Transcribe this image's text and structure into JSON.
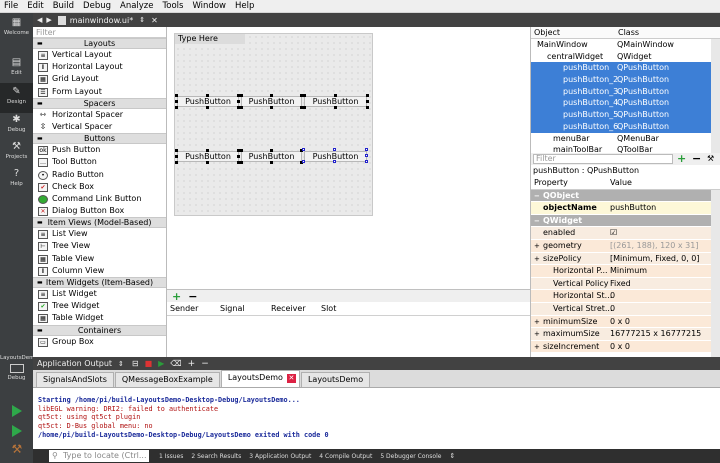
{
  "menubar": [
    "File",
    "Edit",
    "Build",
    "Debug",
    "Analyze",
    "Tools",
    "Window",
    "Help"
  ],
  "modes": [
    {
      "label": "Welcome",
      "icon": "grid-icon"
    },
    {
      "label": "Edit",
      "icon": "document-icon"
    },
    {
      "label": "Design",
      "icon": "pencil-icon"
    },
    {
      "label": "Debug",
      "icon": "bug-icon"
    },
    {
      "label": "Projects",
      "icon": "wrench-icon"
    },
    {
      "label": "Help",
      "icon": "help-icon"
    }
  ],
  "target": {
    "project": "LayoutsDemo",
    "mode": "Debug"
  },
  "editor": {
    "filename": "mainwindow.ui*"
  },
  "widgetbox": {
    "filter_placeholder": "Filter",
    "layouts": {
      "title": "Layouts",
      "items": [
        "Vertical Layout",
        "Horizontal Layout",
        "Grid Layout",
        "Form Layout"
      ]
    },
    "spacers": {
      "title": "Spacers",
      "items": [
        "Horizontal Spacer",
        "Vertical Spacer"
      ]
    },
    "buttons": {
      "title": "Buttons",
      "items": [
        "Push Button",
        "Tool Button",
        "Radio Button",
        "Check Box",
        "Command Link Button",
        "Dialog Button Box"
      ]
    },
    "itemviews": {
      "title": "Item Views (Model-Based)",
      "items": [
        "List View",
        "Tree View",
        "Table View",
        "Column View"
      ]
    },
    "itemwidgets": {
      "title": "Item Widgets (Item-Based)",
      "items": [
        "List Widget",
        "Tree Widget",
        "Table Widget"
      ]
    },
    "containers": {
      "title": "Containers",
      "items": [
        "Group Box"
      ]
    }
  },
  "form": {
    "title": "Type Here",
    "row1": [
      "PushButton",
      "PushButton",
      "PushButton"
    ],
    "row2": [
      "PushButton",
      "PushButton",
      "PushButton"
    ]
  },
  "signals": {
    "add": "+",
    "remove": "−",
    "columns": [
      "Sender",
      "Signal",
      "Receiver",
      "Slot"
    ]
  },
  "objinspector": {
    "columns": [
      "Object",
      "Class"
    ],
    "rows": [
      {
        "object": "MainWindow",
        "class": "QMainWindow",
        "sel": false,
        "indent": 6
      },
      {
        "object": "centralWidget",
        "class": "QWidget",
        "sel": false,
        "indent": 16
      },
      {
        "object": "pushButton",
        "class": "QPushButton",
        "sel": true,
        "indent": 32
      },
      {
        "object": "pushButton_2",
        "class": "QPushButton",
        "sel": true,
        "indent": 32
      },
      {
        "object": "pushButton_3",
        "class": "QPushButton",
        "sel": true,
        "indent": 32
      },
      {
        "object": "pushButton_4",
        "class": "QPushButton",
        "sel": true,
        "indent": 32
      },
      {
        "object": "pushButton_5",
        "class": "QPushButton",
        "sel": true,
        "indent": 32
      },
      {
        "object": "pushButton_6",
        "class": "QPushButton",
        "sel": true,
        "indent": 32
      },
      {
        "object": "menuBar",
        "class": "QMenuBar",
        "sel": false,
        "indent": 22
      },
      {
        "object": "mainToolBar",
        "class": "QToolBar",
        "sel": false,
        "indent": 22
      }
    ]
  },
  "propeditor": {
    "filter_placeholder": "Filter",
    "class_line": "pushButton : QPushButton",
    "columns": [
      "Property",
      "Value"
    ],
    "rows": [
      {
        "name": "QObject",
        "value": "",
        "kind": "grp"
      },
      {
        "name": "objectName",
        "value": "pushButton",
        "kind": "a",
        "bold": true
      },
      {
        "name": "QWidget",
        "value": "",
        "kind": "grp"
      },
      {
        "name": "enabled",
        "value": "☑",
        "kind": "c"
      },
      {
        "name": "geometry",
        "value": "[(261, 188), 120 x 31]",
        "kind": "d",
        "exp": true,
        "grey": true
      },
      {
        "name": "sizePolicy",
        "value": "[Minimum, Fixed, 0, 0]",
        "kind": "c",
        "exp": true
      },
      {
        "name": "Horizontal P...",
        "value": "Minimum",
        "kind": "d",
        "sub": true
      },
      {
        "name": "Vertical Policy",
        "value": "Fixed",
        "kind": "c",
        "sub": true
      },
      {
        "name": "Horizontal St...",
        "value": "0",
        "kind": "d",
        "sub": true
      },
      {
        "name": "Vertical Stret...",
        "value": "0",
        "kind": "c",
        "sub": true
      },
      {
        "name": "minimumSize",
        "value": "0 x 0",
        "kind": "d",
        "exp": true
      },
      {
        "name": "maximumSize",
        "value": "16777215 x 16777215",
        "kind": "c",
        "exp": true
      },
      {
        "name": "sizeIncrement",
        "value": "0 x 0",
        "kind": "d",
        "exp": true
      }
    ]
  },
  "output": {
    "header": "Application Output",
    "tabs": [
      {
        "label": "SignalsAndSlots",
        "active": false,
        "close": false
      },
      {
        "label": "QMessageBoxExample",
        "active": false,
        "close": false
      },
      {
        "label": "LayoutsDemo",
        "active": true,
        "close": true
      },
      {
        "label": "LayoutsDemo",
        "active": false,
        "close": false
      }
    ],
    "lines": [
      {
        "text": "Starting /home/pi/build-LayoutsDemo-Desktop-Debug/LayoutsDemo...",
        "color": "#1a2a9a",
        "bold": true
      },
      {
        "text": "libEGL warning: DRI2: failed to authenticate",
        "color": "#b01010",
        "bold": false
      },
      {
        "text": "qt5ct: using qt5ct plugin",
        "color": "#b01010",
        "bold": false
      },
      {
        "text": "qt5ct: D-Bus global menu: no",
        "color": "#b01010",
        "bold": false
      },
      {
        "text": "/home/pi/build-LayoutsDemo-Desktop-Debug/LayoutsDemo exited with code 0",
        "color": "#1a2a9a",
        "bold": true
      }
    ]
  },
  "statusbar": {
    "locate_placeholder": "Type to locate (Ctrl...",
    "panes": [
      "1  Issues",
      "2  Search Results",
      "3  Application Output",
      "4  Compile Output",
      "5  Debugger Console"
    ]
  },
  "colors": {
    "selection": "#3d7fd6",
    "dark": "#424242",
    "modebar": "#3c3f41"
  }
}
